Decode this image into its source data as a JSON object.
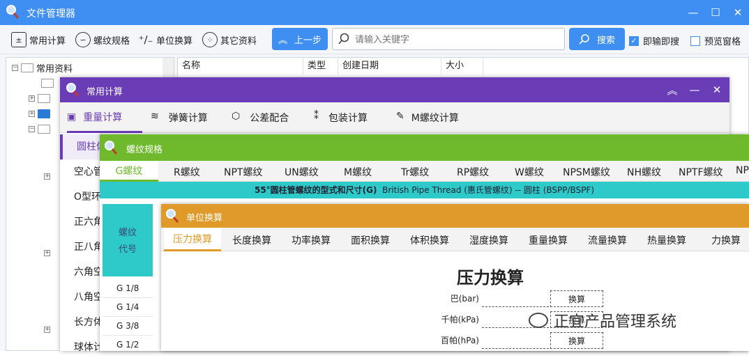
{
  "main": {
    "title": "文件管理器",
    "toolbar": [
      {
        "label": "常用计算",
        "icon": "calculator-icon"
      },
      {
        "label": "螺纹规格",
        "icon": "thread-icon"
      },
      {
        "label": "单位换算",
        "icon": "plus-minus-icon"
      },
      {
        "label": "其它资料",
        "icon": "grid-icon"
      }
    ],
    "back_label": "上一步",
    "search": {
      "placeholder": "请输入关键字"
    },
    "search_button": "搜索",
    "instant_search_label": "即输即搜",
    "preview_label": "预览窗格",
    "tree": {
      "root": "常用资料"
    },
    "columns": [
      "名称",
      "类型",
      "创建日期",
      "大小"
    ]
  },
  "calc_window": {
    "title": "常用计算",
    "tabs": [
      "重量计算",
      "弹簧计算",
      "公差配合",
      "包装计算",
      "M螺纹计算"
    ],
    "side_items": [
      "圆柱体",
      "空心管",
      "O型环",
      "正六角",
      "正八角",
      "六角空",
      "八角空",
      "长方体",
      "球体计"
    ]
  },
  "thread_window": {
    "title": "螺纹规格",
    "tabs": [
      "G螺纹",
      "R螺纹",
      "NPT螺纹",
      "UN螺纹",
      "M螺纹",
      "Tr螺纹",
      "RP螺纹",
      "W螺纹",
      "NPSM螺纹",
      "NH螺纹",
      "NPTF螺纹",
      "NP"
    ],
    "caption_bold": "55°圆柱管螺纹的型式和尺寸(G)",
    "caption_rest": "British Pipe Thread (惠氏管螺纹) -- 圆柱 (BSPP/BSPF)",
    "header_line1": "螺纹",
    "header_line2": "代号",
    "rows": [
      "G 1/8",
      "G 1/4",
      "G 3/8",
      "G 1/2"
    ]
  },
  "unit_window": {
    "title": "单位换算",
    "tabs": [
      "压力换算",
      "长度换算",
      "功率换算",
      "面积换算",
      "体积换算",
      "湿度换算",
      "重量换算",
      "流量换算",
      "热量换算",
      "力换算"
    ],
    "heading": "压力换算",
    "fields": [
      {
        "label": "巴(bar)",
        "button": "换算"
      },
      {
        "label": "千帕(kPa)",
        "button": "换算"
      },
      {
        "label": "百帕(hPa)",
        "button": "换算"
      }
    ]
  },
  "watermark": "正宜产品管理系统",
  "colors": {
    "main": "#3f8ff3",
    "calc": "#6a3db6",
    "thread": "#6fba2c",
    "unit": "#e09a2a",
    "caption": "#2ec9c9"
  }
}
